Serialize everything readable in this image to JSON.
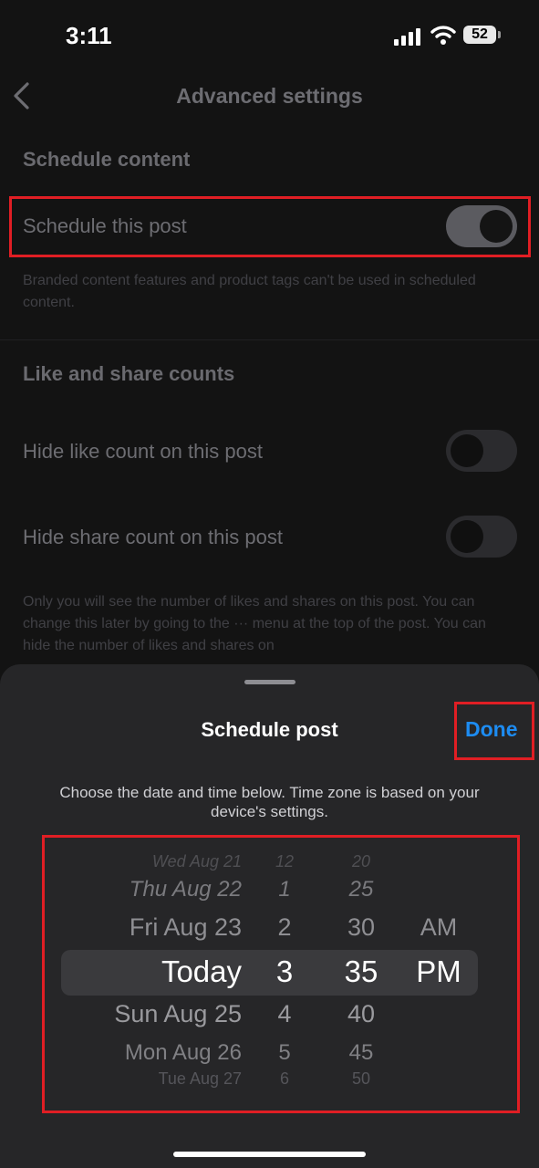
{
  "status_bar": {
    "time": "3:11",
    "battery": "52"
  },
  "header": {
    "title": "Advanced settings"
  },
  "schedule_section": {
    "heading": "Schedule content",
    "toggle_label": "Schedule this post",
    "toggle_on": true,
    "note": "Branded content features and product tags can't be used in scheduled content."
  },
  "counts_section": {
    "heading": "Like and share counts",
    "hide_like_label": "Hide like count on this post",
    "hide_share_label": "Hide share count on this post",
    "note": "Only you will see the number of likes and shares on this post. You can change this later by going to the ··· menu at the top of the post. You can hide the number of likes and shares on"
  },
  "sheet": {
    "title": "Schedule post",
    "done_label": "Done",
    "description": "Choose the date and time below. Time zone is based on your device's settings.",
    "picker": {
      "dates": [
        "Wed Aug 21",
        "Thu Aug 22",
        "Fri Aug 23",
        "Today",
        "Sun Aug 25",
        "Mon Aug 26",
        "Tue Aug 27"
      ],
      "hours": [
        "12",
        "1",
        "2",
        "3",
        "4",
        "5",
        "6"
      ],
      "minutes": [
        "20",
        "25",
        "30",
        "35",
        "40",
        "45",
        "50"
      ],
      "ampm": [
        "AM",
        "PM"
      ],
      "selected": {
        "date": "Today",
        "hour": "3",
        "minute": "35",
        "ampm": "PM"
      }
    }
  }
}
